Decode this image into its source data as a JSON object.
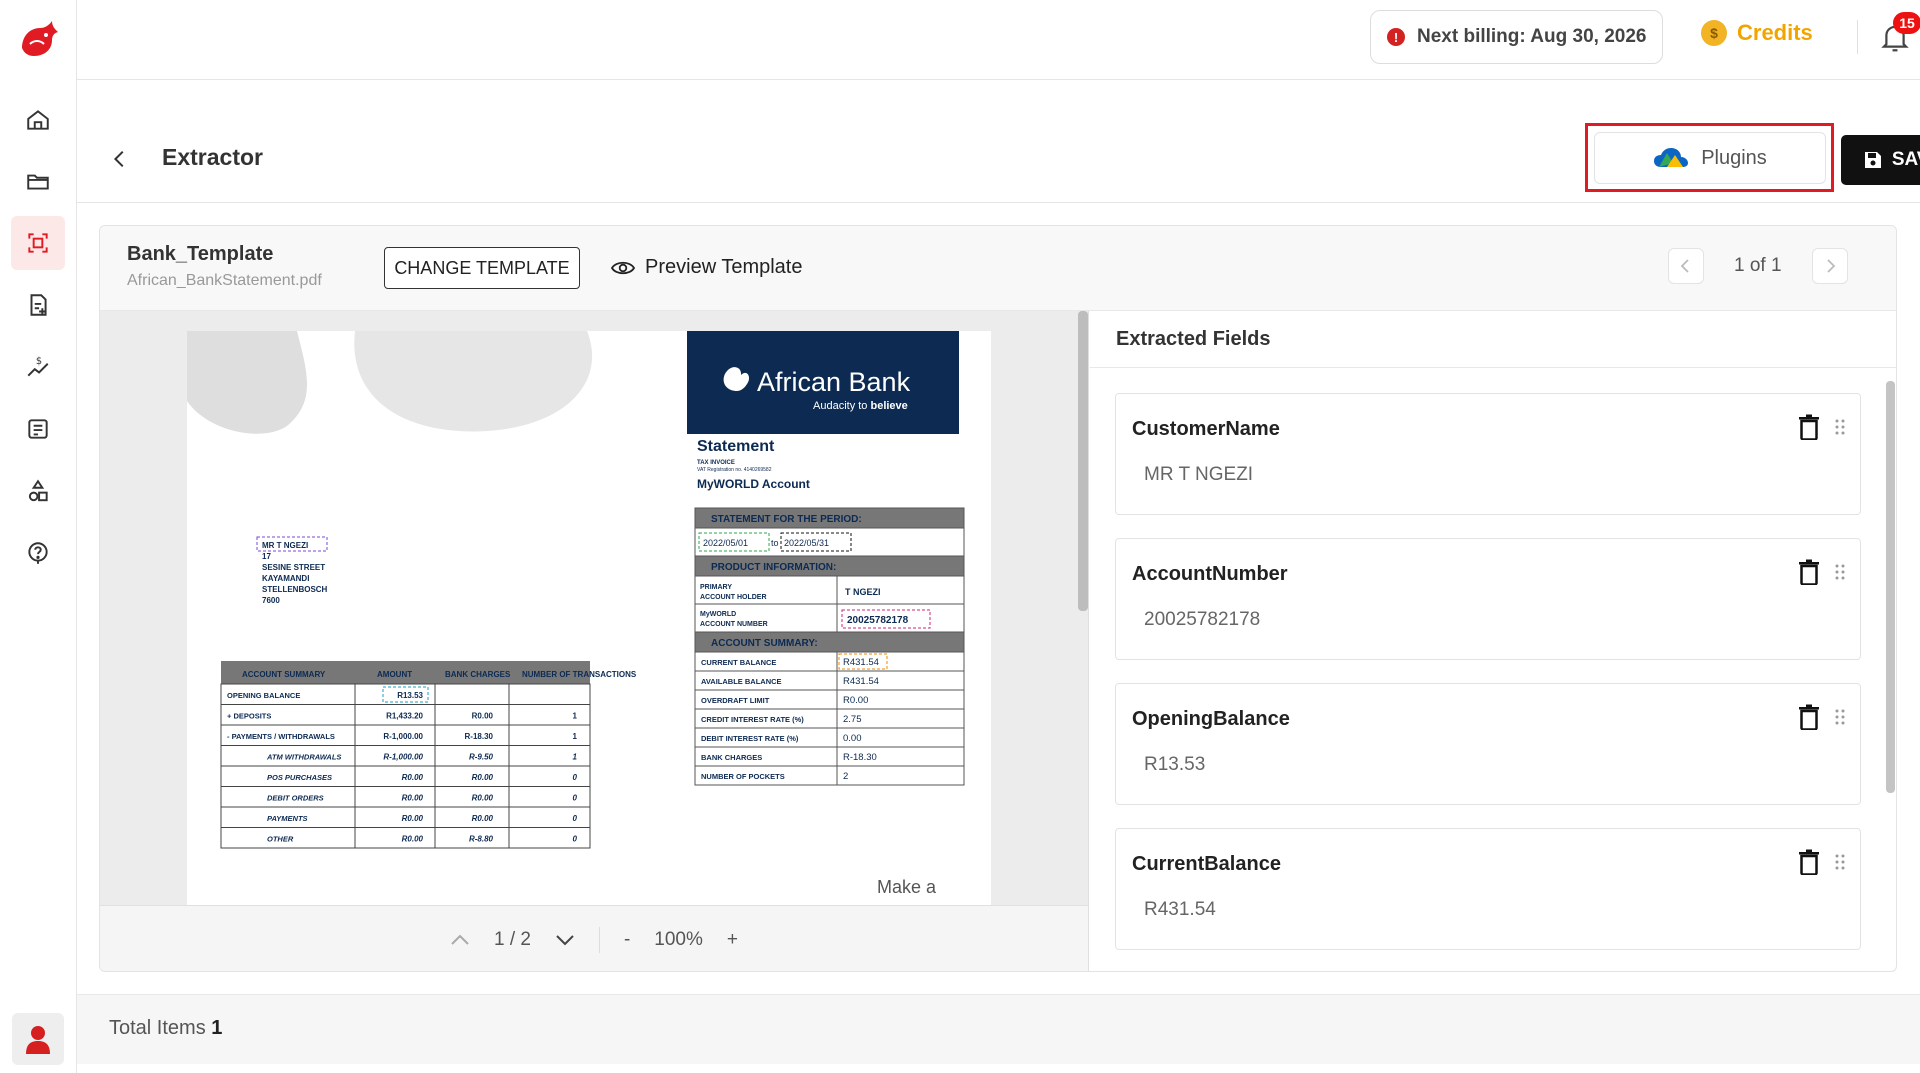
{
  "topbar": {
    "billing_text": "Next billing: Aug 30, 2026",
    "credits_label": "Credits",
    "notification_count": "15"
  },
  "header": {
    "title": "Extractor",
    "plugins_label": "Plugins",
    "save_label": "SAVE"
  },
  "template": {
    "name": "Bank_Template",
    "file": "African_BankStatement.pdf",
    "change_label": "CHANGE TEMPLATE",
    "preview_label": "Preview Template",
    "pager_text": "1 of 1"
  },
  "viewer": {
    "page_indicator": "1 / 2",
    "zoom": "100%",
    "zoom_out": "-",
    "zoom_in": "+"
  },
  "document": {
    "bank_name": "African Bank",
    "tagline_prefix": "Audacity to ",
    "tagline_bold": "believe",
    "statement_title": "Statement",
    "tax_invoice": "TAX INVOICE",
    "vat_line": "VAT Registration no. 4140269582",
    "account_type": "MyWORLD Account",
    "period_header": "STATEMENT FOR THE PERIOD:",
    "period_from": "2022/05/01",
    "period_to_word": "to",
    "period_to": "2022/05/31",
    "product_header": "PRODUCT INFORMATION:",
    "primary_holder_label": "PRIMARY ACCOUNT HOLDER",
    "primary_holder_value": "T NGEZI",
    "account_number_label": "MyWORLD ACCOUNT NUMBER",
    "account_number_value": "20025782178",
    "summary_header": "ACCOUNT SUMMARY:",
    "summary_rows": [
      {
        "label": "CURRENT BALANCE",
        "value": "R431.54"
      },
      {
        "label": "AVAILABLE BALANCE",
        "value": "R431.54"
      },
      {
        "label": "OVERDRAFT LIMIT",
        "value": "R0.00"
      },
      {
        "label": "CREDIT INTEREST RATE (%)",
        "value": "2.75"
      },
      {
        "label": "DEBIT INTEREST RATE (%)",
        "value": "0.00"
      },
      {
        "label": "BANK CHARGES",
        "value": "R-18.30"
      },
      {
        "label": "NUMBER OF POCKETS",
        "value": "2"
      }
    ],
    "address_name": "MR T NGEZI",
    "address_lines": [
      "17",
      "SESINE STREET",
      "KAYAMANDI",
      "STELLENBOSCH",
      "7600"
    ],
    "table_headers": [
      "ACCOUNT SUMMARY",
      "AMOUNT",
      "BANK CHARGES",
      "NUMBER OF TRANSACTIONS"
    ],
    "table_rows": [
      {
        "label": "OPENING BALANCE",
        "amount": "R13.53",
        "charges": "",
        "count": ""
      },
      {
        "label": "+ DEPOSITS",
        "amount": "R1,433.20",
        "charges": "R0.00",
        "count": "1"
      },
      {
        "label": "- PAYMENTS / WITHDRAWALS",
        "amount": "R-1,000.00",
        "charges": "R-18.30",
        "count": "1"
      },
      {
        "label": "ATM WITHDRAWALS",
        "amount": "R-1,000.00",
        "charges": "R-9.50",
        "count": "1"
      },
      {
        "label": "POS PURCHASES",
        "amount": "R0.00",
        "charges": "R0.00",
        "count": "0"
      },
      {
        "label": "DEBIT ORDERS",
        "amount": "R0.00",
        "charges": "R0.00",
        "count": "0"
      },
      {
        "label": "PAYMENTS",
        "amount": "R0.00",
        "charges": "R0.00",
        "count": "0"
      },
      {
        "label": "OTHER",
        "amount": "R0.00",
        "charges": "R-8.80",
        "count": "0"
      }
    ],
    "promo_text": "Make a"
  },
  "fields": {
    "title": "Extracted Fields",
    "items": [
      {
        "name": "CustomerName",
        "value": "MR T NGEZI"
      },
      {
        "name": "AccountNumber",
        "value": "20025782178"
      },
      {
        "name": "OpeningBalance",
        "value": "R13.53"
      },
      {
        "name": "CurrentBalance",
        "value": "R431.54"
      }
    ]
  },
  "footer": {
    "total_label": "Total Items",
    "total_count": "1"
  },
  "colors": {
    "accent": "#e01b24",
    "bank_navy": "#0c2a52",
    "credits": "#f2a500"
  }
}
